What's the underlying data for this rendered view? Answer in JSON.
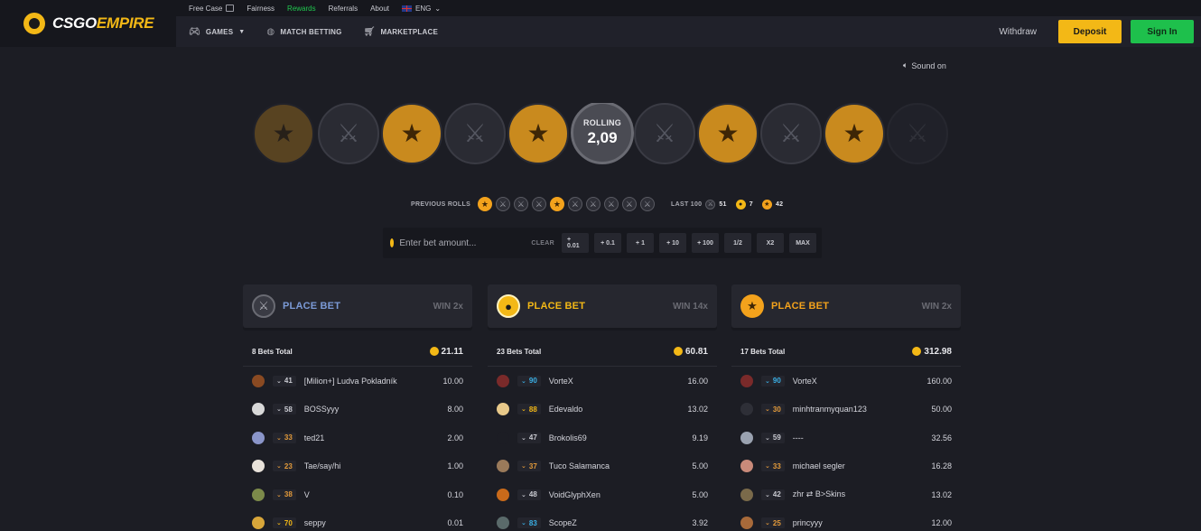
{
  "brand": {
    "left": "CSGO",
    "right": "EMPIRE"
  },
  "topbar": {
    "items": [
      "Free Case",
      "Fairness",
      "Rewards",
      "Referrals",
      "About"
    ],
    "lang": "ENG"
  },
  "nav": {
    "games": "GAMES",
    "match_betting": "MATCH BETTING",
    "marketplace": "MARKETPLACE",
    "withdraw": "Withdraw",
    "deposit": "Deposit",
    "signin": "Sign In"
  },
  "sound": "Sound on",
  "roll": {
    "label": "ROLLING",
    "value": "2,09"
  },
  "previous": {
    "label": "PREVIOUS ROLLS",
    "rolls": [
      "t",
      "ct",
      "ct",
      "ct",
      "t",
      "ct",
      "ct",
      "ct",
      "ct",
      "ct"
    ],
    "last100_label": "LAST 100",
    "ct_count": "51",
    "bonus_count": "7",
    "t_count": "42"
  },
  "bet": {
    "placeholder": "Enter bet amount...",
    "clear": "CLEAR",
    "buttons": [
      "+ 0.01",
      "+ 0.1",
      "+ 1",
      "+ 10",
      "+ 100",
      "1/2",
      "X2",
      "MAX"
    ]
  },
  "columns": [
    {
      "type": "ct",
      "place": "PLACE BET",
      "win": "WIN 2x",
      "color": "#7b9ad6",
      "bets_total": "8 Bets Total",
      "total": "21.11",
      "rows": [
        {
          "lvl": "41",
          "lvl_color": "#c9cad1",
          "avatar": "#8a4a22",
          "name": "[Milion+] Ludva Pokladník",
          "amount": "10.00"
        },
        {
          "lvl": "58",
          "lvl_color": "#c9cad1",
          "avatar": "#d8d8d8",
          "name": "BOSSyyy",
          "amount": "8.00"
        },
        {
          "lvl": "33",
          "lvl_color": "#e39a3a",
          "avatar": "#8a95c9",
          "name": "ted21",
          "amount": "2.00"
        },
        {
          "lvl": "23",
          "lvl_color": "#e39a3a",
          "avatar": "#e8e2da",
          "name": "Tae/say/hi",
          "amount": "1.00"
        },
        {
          "lvl": "38",
          "lvl_color": "#e39a3a",
          "avatar": "#7c8a4a",
          "name": "V",
          "amount": "0.10"
        },
        {
          "lvl": "70",
          "lvl_color": "#f3b816",
          "avatar": "#d8a63a",
          "name": "seppy",
          "amount": "0.01"
        }
      ]
    },
    {
      "type": "bonus",
      "place": "PLACE BET",
      "win": "WIN 14x",
      "color": "#f3b816",
      "bets_total": "23 Bets Total",
      "total": "60.81",
      "rows": [
        {
          "lvl": "90",
          "lvl_color": "#3ab0e6",
          "avatar": "#7a2a2a",
          "name": "VorteX",
          "amount": "16.00"
        },
        {
          "lvl": "88",
          "lvl_color": "#f3b816",
          "avatar": "#e8c98a",
          "name": "Edevaldo",
          "amount": "13.02"
        },
        {
          "lvl": "47",
          "lvl_color": "#c9cad1",
          "avatar": "#1c1d24",
          "name": "Brokolis69",
          "amount": "9.19"
        },
        {
          "lvl": "37",
          "lvl_color": "#e39a3a",
          "avatar": "#9a7a5a",
          "name": "Tuco Salamanca",
          "amount": "5.00"
        },
        {
          "lvl": "48",
          "lvl_color": "#c9cad1",
          "avatar": "#c96a1a",
          "name": "VoidGlyphXen",
          "amount": "5.00"
        },
        {
          "lvl": "83",
          "lvl_color": "#3ab0e6",
          "avatar": "#5a6a6a",
          "name": "ScopeZ",
          "amount": "3.92"
        }
      ]
    },
    {
      "type": "t",
      "place": "PLACE BET",
      "win": "WIN 2x",
      "color": "#f3a21c",
      "bets_total": "17 Bets Total",
      "total": "312.98",
      "rows": [
        {
          "lvl": "90",
          "lvl_color": "#3ab0e6",
          "avatar": "#7a2a2a",
          "name": "VorteX",
          "amount": "160.00"
        },
        {
          "lvl": "30",
          "lvl_color": "#e39a3a",
          "avatar": "#2e2f37",
          "name": "minhtranmyquan123",
          "amount": "50.00"
        },
        {
          "lvl": "59",
          "lvl_color": "#c9cad1",
          "avatar": "#9aa2b0",
          "name": "----",
          "amount": "32.56"
        },
        {
          "lvl": "33",
          "lvl_color": "#e39a3a",
          "avatar": "#c98a7a",
          "name": "michael segler",
          "amount": "16.28"
        },
        {
          "lvl": "42",
          "lvl_color": "#c9cad1",
          "avatar": "#7a6a4a",
          "name": "zhr ⇄ B>Skins",
          "amount": "13.02"
        },
        {
          "lvl": "25",
          "lvl_color": "#e39a3a",
          "avatar": "#a86a3a",
          "name": "princyyy",
          "amount": "12.00"
        }
      ]
    }
  ],
  "icons": {
    "t_glyph": "★",
    "ct_glyph": "⚔"
  }
}
